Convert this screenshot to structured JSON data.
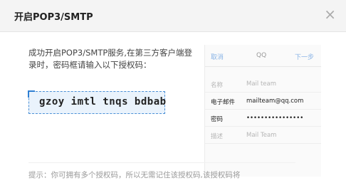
{
  "dialog": {
    "title": "开启POP3/SMTP",
    "close_label": "×"
  },
  "content": {
    "success_text": "成功开启POP3/SMTP服务,在第三方客户端登录时，密码框请输入以下授权码：",
    "auth_code": "gzoy imtl tnqs bdbab",
    "hint": "提示：你可拥有多个授权码，所以无需记住该授权码,该授权码将"
  },
  "client_preview": {
    "cancel": "取消",
    "title": "QQ",
    "next": "下一步",
    "rows": [
      {
        "label": "名称",
        "value": "Mail team"
      },
      {
        "label": "电子邮件",
        "value": "mailteam@qq.com"
      },
      {
        "label": "密码",
        "value": "••••••••••••••••"
      },
      {
        "label": "描述",
        "value": "Mail Team"
      }
    ]
  }
}
